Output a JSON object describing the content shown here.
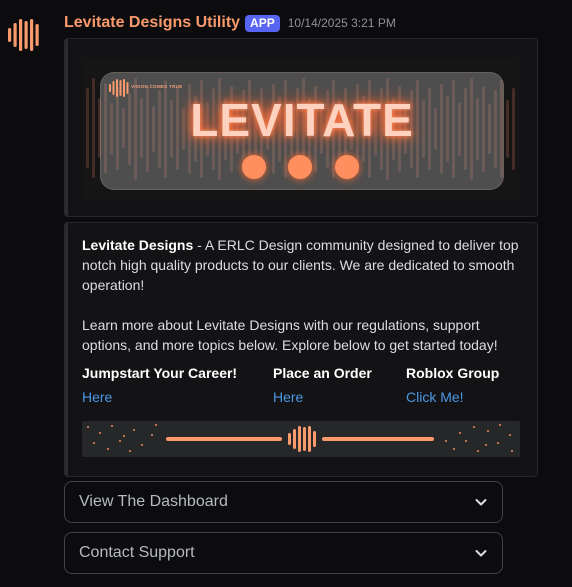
{
  "message": {
    "author": "Levitate Designs Utility",
    "badge": "APP",
    "timestamp": "10/14/2025 3:21 PM"
  },
  "banner": {
    "tagline": "VISION COMES TRUE",
    "title": "LEVITATE"
  },
  "embed": {
    "brand": "Levitate Designs",
    "intro_rest": " - A ERLC Design community designed to deliver top notch high quality products to our clients. We are dedicated to smooth operation!",
    "paragraph2": "Learn more about Levitate Designs with our regulations, support options, and more topics below. Explore below to get started today!",
    "fields": [
      {
        "name": "Jumpstart Your Career!",
        "value": "Here"
      },
      {
        "name": "Place an Order",
        "value": "Here"
      },
      {
        "name": "Roblox Group",
        "value": "Click Me!"
      }
    ]
  },
  "selects": [
    {
      "label": "View The Dashboard"
    },
    {
      "label": "Contact Support"
    }
  ],
  "colors": {
    "brand_orange": "#f89a6b",
    "link_blue": "#4b97e4",
    "badge_blurple": "#5865f2"
  },
  "icons": {
    "avatar": "sound-wave-icon",
    "select_chevron": "chevron-down-icon"
  }
}
